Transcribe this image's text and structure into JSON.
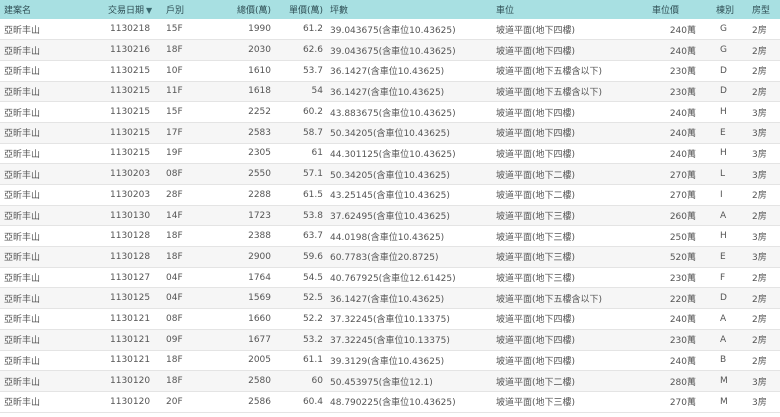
{
  "headers": {
    "name": "建案名",
    "date": "交易日期",
    "sort_icon": "▼",
    "floor": "戶別",
    "total": "總價(萬)",
    "unit": "單價(萬)",
    "area": "坪數",
    "parking": "車位",
    "parking_price": "車位價",
    "building": "棟別",
    "room": "房型"
  },
  "rows": [
    {
      "name": "亞昕丰山",
      "date": "1130218",
      "floor": "15F",
      "total": "1990",
      "unit": "61.2",
      "area": "39.043675(含車位10.43625)",
      "parking": "坡道平面(地下四樓)",
      "parking_price": "240萬",
      "building": "G",
      "room": "2房"
    },
    {
      "name": "亞昕丰山",
      "date": "1130216",
      "floor": "18F",
      "total": "2030",
      "unit": "62.6",
      "area": "39.043675(含車位10.43625)",
      "parking": "坡道平面(地下四樓)",
      "parking_price": "240萬",
      "building": "G",
      "room": "2房"
    },
    {
      "name": "亞昕丰山",
      "date": "1130215",
      "floor": "10F",
      "total": "1610",
      "unit": "53.7",
      "area": "36.1427(含車位10.43625)",
      "parking": "坡道平面(地下五樓含以下)",
      "parking_price": "230萬",
      "building": "D",
      "room": "2房"
    },
    {
      "name": "亞昕丰山",
      "date": "1130215",
      "floor": "11F",
      "total": "1618",
      "unit": "54",
      "area": "36.1427(含車位10.43625)",
      "parking": "坡道平面(地下五樓含以下)",
      "parking_price": "230萬",
      "building": "D",
      "room": "2房"
    },
    {
      "name": "亞昕丰山",
      "date": "1130215",
      "floor": "15F",
      "total": "2252",
      "unit": "60.2",
      "area": "43.883675(含車位10.43625)",
      "parking": "坡道平面(地下四樓)",
      "parking_price": "240萬",
      "building": "H",
      "room": "3房"
    },
    {
      "name": "亞昕丰山",
      "date": "1130215",
      "floor": "17F",
      "total": "2583",
      "unit": "58.7",
      "area": "50.34205(含車位10.43625)",
      "parking": "坡道平面(地下四樓)",
      "parking_price": "240萬",
      "building": "E",
      "room": "3房"
    },
    {
      "name": "亞昕丰山",
      "date": "1130215",
      "floor": "19F",
      "total": "2305",
      "unit": "61",
      "area": "44.301125(含車位10.43625)",
      "parking": "坡道平面(地下四樓)",
      "parking_price": "240萬",
      "building": "H",
      "room": "3房"
    },
    {
      "name": "亞昕丰山",
      "date": "1130203",
      "floor": "08F",
      "total": "2550",
      "unit": "57.1",
      "area": "50.34205(含車位10.43625)",
      "parking": "坡道平面(地下二樓)",
      "parking_price": "270萬",
      "building": "L",
      "room": "3房"
    },
    {
      "name": "亞昕丰山",
      "date": "1130203",
      "floor": "28F",
      "total": "2288",
      "unit": "61.5",
      "area": "43.25145(含車位10.43625)",
      "parking": "坡道平面(地下二樓)",
      "parking_price": "270萬",
      "building": "I",
      "room": "2房"
    },
    {
      "name": "亞昕丰山",
      "date": "1130130",
      "floor": "14F",
      "total": "1723",
      "unit": "53.8",
      "area": "37.62495(含車位10.43625)",
      "parking": "坡道平面(地下三樓)",
      "parking_price": "260萬",
      "building": "A",
      "room": "2房"
    },
    {
      "name": "亞昕丰山",
      "date": "1130128",
      "floor": "18F",
      "total": "2388",
      "unit": "63.7",
      "area": "44.0198(含車位10.43625)",
      "parking": "坡道平面(地下三樓)",
      "parking_price": "250萬",
      "building": "H",
      "room": "3房"
    },
    {
      "name": "亞昕丰山",
      "date": "1130128",
      "floor": "18F",
      "total": "2900",
      "unit": "59.6",
      "area": "60.7783(含車位20.8725)",
      "parking": "坡道平面(地下三樓)",
      "parking_price": "520萬",
      "building": "E",
      "room": "3房"
    },
    {
      "name": "亞昕丰山",
      "date": "1130127",
      "floor": "04F",
      "total": "1764",
      "unit": "54.5",
      "area": "40.767925(含車位12.61425)",
      "parking": "坡道平面(地下三樓)",
      "parking_price": "230萬",
      "building": "F",
      "room": "2房"
    },
    {
      "name": "亞昕丰山",
      "date": "1130125",
      "floor": "04F",
      "total": "1569",
      "unit": "52.5",
      "area": "36.1427(含車位10.43625)",
      "parking": "坡道平面(地下五樓含以下)",
      "parking_price": "220萬",
      "building": "D",
      "room": "2房"
    },
    {
      "name": "亞昕丰山",
      "date": "1130121",
      "floor": "08F",
      "total": "1660",
      "unit": "52.2",
      "area": "37.32245(含車位10.13375)",
      "parking": "坡道平面(地下四樓)",
      "parking_price": "240萬",
      "building": "A",
      "room": "2房"
    },
    {
      "name": "亞昕丰山",
      "date": "1130121",
      "floor": "09F",
      "total": "1677",
      "unit": "53.2",
      "area": "37.32245(含車位10.13375)",
      "parking": "坡道平面(地下四樓)",
      "parking_price": "230萬",
      "building": "A",
      "room": "2房"
    },
    {
      "name": "亞昕丰山",
      "date": "1130121",
      "floor": "18F",
      "total": "2005",
      "unit": "61.1",
      "area": "39.3129(含車位10.43625)",
      "parking": "坡道平面(地下四樓)",
      "parking_price": "240萬",
      "building": "B",
      "room": "2房"
    },
    {
      "name": "亞昕丰山",
      "date": "1130120",
      "floor": "18F",
      "total": "2580",
      "unit": "60",
      "area": "50.453975(含車位12.1)",
      "parking": "坡道平面(地下二樓)",
      "parking_price": "280萬",
      "building": "M",
      "room": "3房"
    },
    {
      "name": "亞昕丰山",
      "date": "1130120",
      "floor": "20F",
      "total": "2586",
      "unit": "60.4",
      "area": "48.790225(含車位10.43625)",
      "parking": "坡道平面(地下三樓)",
      "parking_price": "270萬",
      "building": "M",
      "room": "3房"
    }
  ]
}
